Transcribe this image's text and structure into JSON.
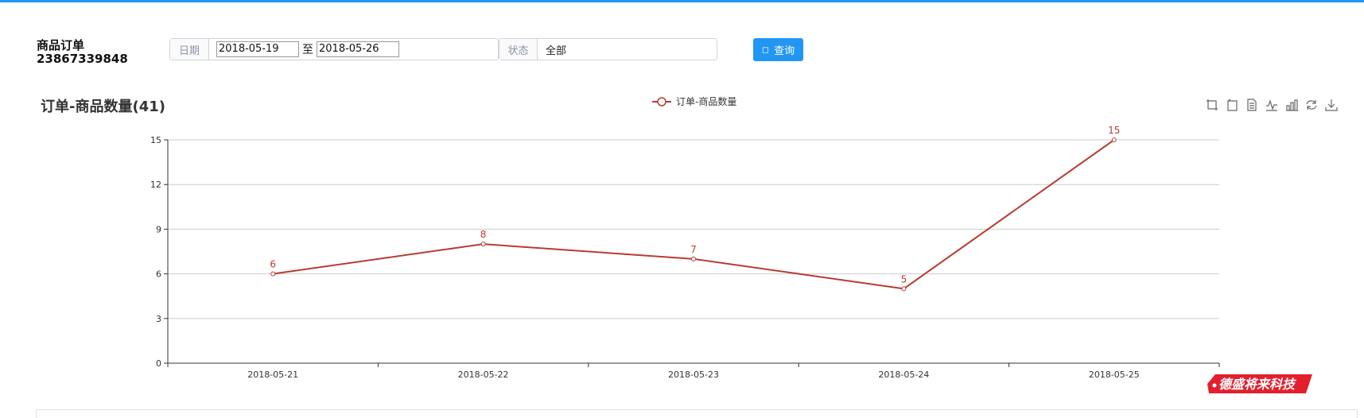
{
  "header": {
    "title": "商品订单",
    "phone": "23867339848"
  },
  "filters": {
    "date_label": "日期",
    "date_start": "2018-05-19",
    "range_separator": "至",
    "date_end": "2018-05-26",
    "status_label": "状态",
    "status_value": "全部",
    "query_button": "查询",
    "query_icon": "search-icon"
  },
  "chart_title": "订单-商品数量(41)",
  "toolbox": {
    "icons": [
      "zoom-icon",
      "zoom-reset-icon",
      "data-view-icon",
      "line-chart-icon",
      "bar-chart-icon",
      "restore-icon",
      "download-icon"
    ]
  },
  "brand": {
    "text": "德盛将来科技",
    "color": "#e31f2e"
  },
  "chart_data": {
    "type": "line",
    "title": "订单-商品数量(41)",
    "x": [
      "2018-05-21",
      "2018-05-22",
      "2018-05-23",
      "2018-05-24",
      "2018-05-25"
    ],
    "series": [
      {
        "name": "订单-商品数量",
        "values": [
          6,
          8,
          7,
          5,
          15
        ],
        "color": "#b83b32"
      }
    ],
    "ylim": [
      0,
      15
    ],
    "yticks": [
      0,
      3,
      6,
      9,
      12,
      15
    ],
    "grid": true,
    "legend": "top-center",
    "data_labels": true
  }
}
